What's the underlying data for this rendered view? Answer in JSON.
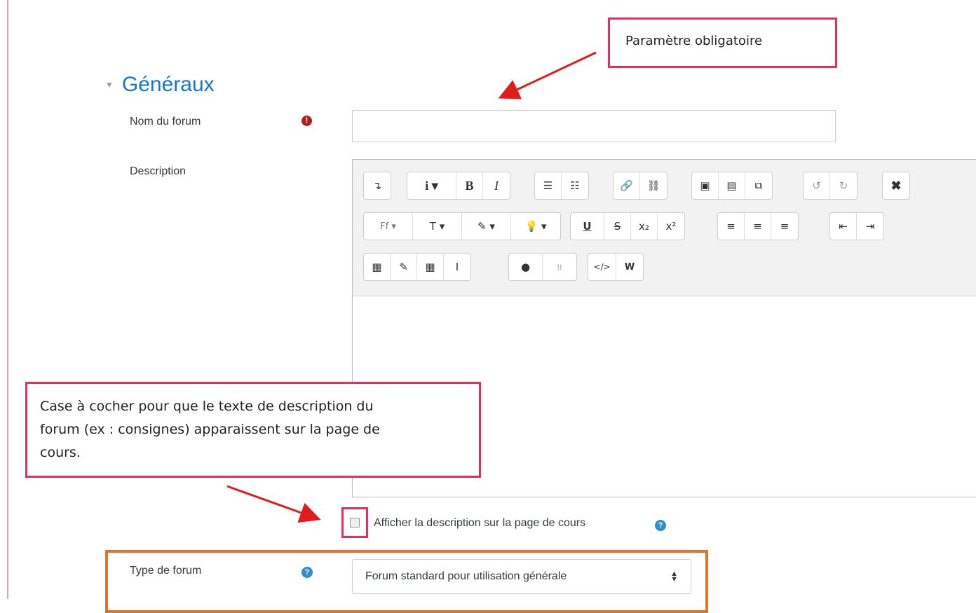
{
  "callouts": {
    "required_param": "Paramètre obligatoire",
    "checkbox_note_line1": "Case à cocher pour que le texte de description du",
    "checkbox_note_line2": "forum (ex : consignes) apparaissent sur la page de",
    "checkbox_note_line3": "cours."
  },
  "section": {
    "title": "Généraux"
  },
  "fields": {
    "forum_name_label": "Nom du forum",
    "forum_name_value": "",
    "description_label": "Description",
    "show_description_label": "Afficher la description sur la page de cours",
    "forum_type_label": "Type de forum",
    "forum_type_value": "Forum standard pour utilisation générale"
  },
  "toolbar": {
    "row1": [
      [
        "↴"
      ],
      [
        "i ▾",
        "B",
        "I"
      ],
      [
        "☰",
        "☷"
      ],
      [
        "🔗",
        "⛓"
      ],
      [
        "▣",
        "▤",
        "⧉"
      ],
      [
        "↺",
        "↻"
      ],
      [
        "✖"
      ]
    ],
    "row2": [
      [
        "Ff ▾",
        "T ▾",
        "✎ ▾",
        "💡 ▾"
      ],
      [
        "U",
        "S",
        "x₂",
        "x²"
      ],
      [
        "≡",
        "≡",
        "≡"
      ],
      [
        "⇤",
        "⇥"
      ]
    ],
    "row3": [
      [
        "▦",
        "✎",
        "▦",
        "I"
      ],
      [
        "●",
        "⁞⁞"
      ],
      [
        "</>",
        "W"
      ]
    ]
  },
  "colors": {
    "accent": "#1177d1",
    "callout_border": "#e0325a",
    "highlight_orange": "#e27522",
    "required_icon": "#b71c1c",
    "help_icon": "#2f8ed1"
  }
}
